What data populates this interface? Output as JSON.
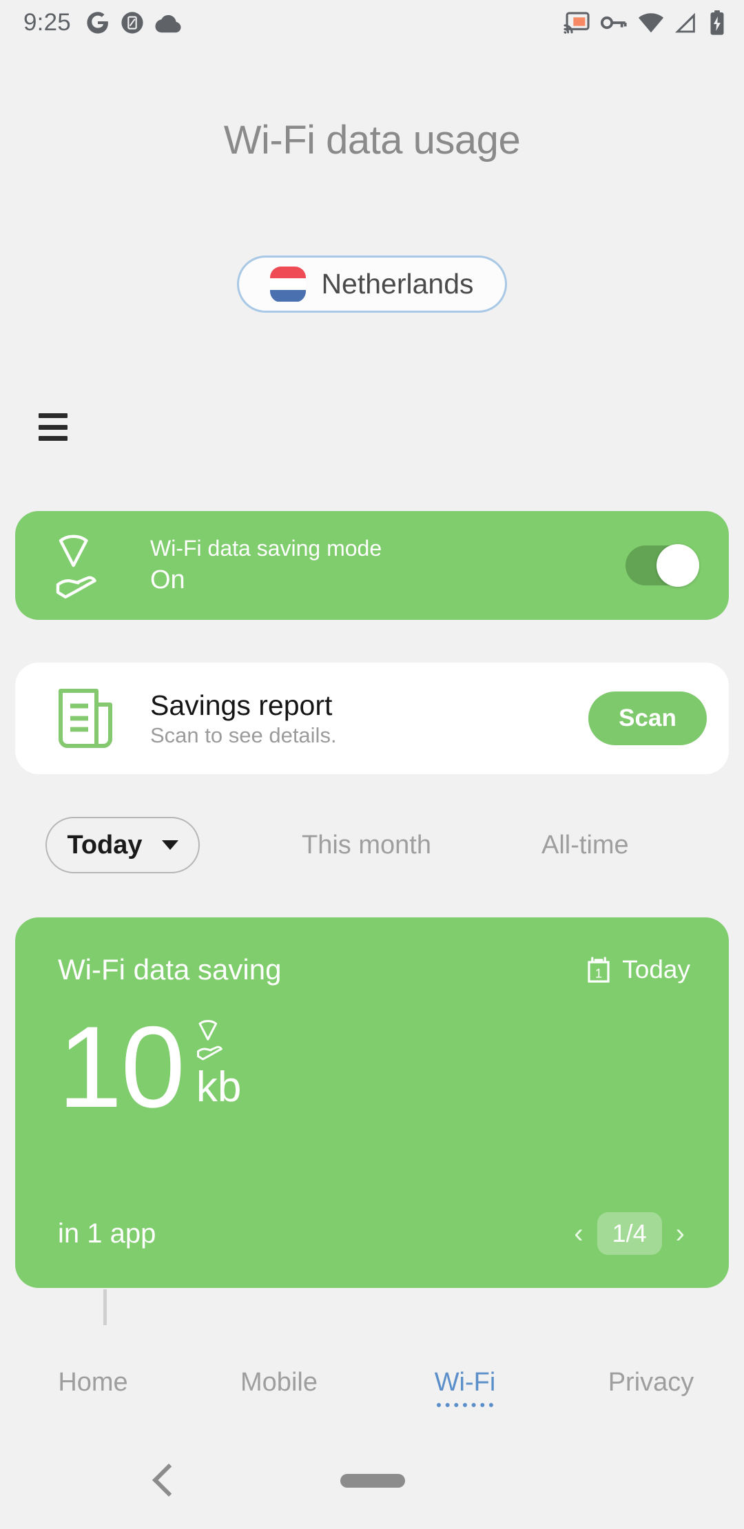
{
  "status_bar": {
    "clock": "9:25",
    "left_icons": [
      "google-icon",
      "screenshot-note-icon",
      "cloud-icon"
    ],
    "right_icons": [
      "cast-icon",
      "vpn-key-icon",
      "wifi-icon",
      "mobile-signal-icon",
      "battery-charging-icon"
    ]
  },
  "header": {
    "title": "Wi-Fi data usage",
    "country": {
      "name": "Netherlands",
      "flag": "netherlands-flag-icon"
    },
    "menu_icon": "hamburger-menu-icon"
  },
  "saving_mode_card": {
    "icon": "wifi-hand-icon",
    "title": "Wi-Fi data saving mode",
    "state": "On",
    "toggle_on": true,
    "bg_color": "#80cd6e"
  },
  "report_card": {
    "icon": "report-document-icon",
    "title": "Savings report",
    "subtitle": "Scan to see details.",
    "action_label": "Scan",
    "action_color": "#7ec96c"
  },
  "period_tabs": {
    "selected": "Today",
    "caret_icon": "chevron-down-icon",
    "options": [
      "This month",
      "All-time"
    ]
  },
  "stats_card": {
    "title": "Wi-Fi data saving",
    "date_icon": "calendar-day-icon",
    "date_label": "Today",
    "value": "10",
    "unit": "kb",
    "value_icon": "wifi-hand-icon",
    "apps_label": "in 1 app",
    "pager": {
      "prev_icon": "chevron-left-icon",
      "count": "1/4",
      "next_icon": "chevron-right-icon"
    },
    "bg_color": "#80cd6e"
  },
  "bottom_tabs": {
    "active_index": 2,
    "accent_color": "#5b8fc9",
    "items": [
      {
        "label": "Home"
      },
      {
        "label": "Mobile"
      },
      {
        "label": "Wi-Fi"
      },
      {
        "label": "Privacy"
      }
    ]
  },
  "android_nav": {
    "back_icon": "back-chevron-icon",
    "home_icon": "home-pill-icon"
  }
}
